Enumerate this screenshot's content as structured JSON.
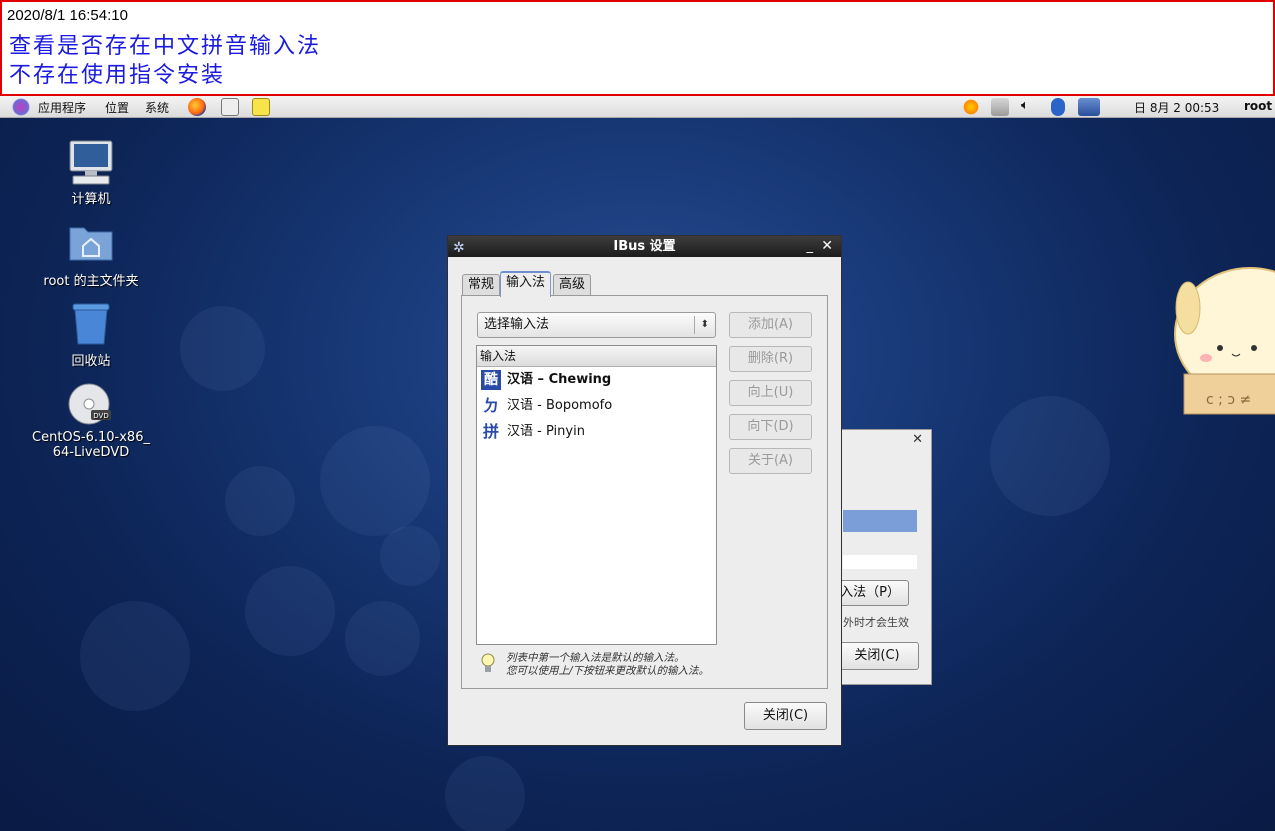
{
  "note": {
    "timestamp": "2020/8/1 16:54:10",
    "line1": "查看是否存在中文拼音输入法",
    "line2": "不存在使用指令安装"
  },
  "panel": {
    "apps": "应用程序",
    "places": "位置",
    "system": "系统",
    "date": "日 8月  2 00:53",
    "user": "root"
  },
  "desktop_icons": {
    "computer": "计算机",
    "home": "root 的主文件夹",
    "trash": "回收站",
    "dvd_line1": "CentOS-6.10-x86_",
    "dvd_line2": "64-LiveDVD"
  },
  "dialog": {
    "title": "IBus 设置",
    "tabs": [
      "常规",
      "输入法",
      "高级"
    ],
    "combo": "选择输入法",
    "buttons": {
      "add": "添加(A)",
      "remove": "删除(R)",
      "up": "向上(U)",
      "down": "向下(D)",
      "about": "关于(A)",
      "close": "关闭(C)"
    },
    "list_header": "输入法",
    "engines": [
      {
        "icon": "酷",
        "lang": "汉语",
        "name": "Chewing",
        "selected": true
      },
      {
        "icon": "ㄉ",
        "lang": "汉语",
        "name": "Bopomofo",
        "selected": false
      },
      {
        "icon": "拼",
        "lang": "汉语",
        "name": "Pinyin",
        "selected": false
      }
    ],
    "hint_line1": "列表中第一个输入法是默认的输入法。",
    "hint_line2": "您可以使用上/下按钮来更改默认的输入法。"
  },
  "dialog2": {
    "button1": "入法（P）",
    "text": "外时才会生效",
    "button2": "关闭(C)"
  },
  "colors": {
    "note_border": "#e00000",
    "note_text": "#1a1ae0",
    "desktop": "#163673",
    "titlebar": "#2a2a2a"
  }
}
